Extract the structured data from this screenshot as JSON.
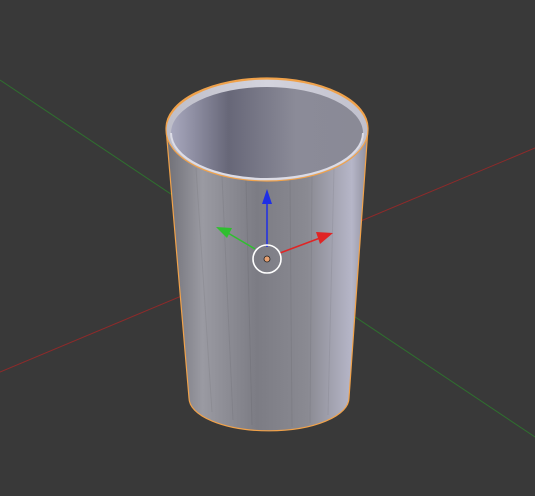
{
  "viewport": {
    "background": "#393939",
    "axes": {
      "x_axis_color": "#8e2a2a",
      "y_axis_color": "#2f6f2f"
    },
    "object": {
      "name": "cup",
      "selected": true,
      "outline_color": "#f1a24a",
      "body_color": "#a9a9b5"
    },
    "gizmo": {
      "z_arrow_color": "#1f2fe6",
      "x_arrow_color": "#e02424",
      "y_arrow_color": "#2fbf2f",
      "pivot_color": "#e7a070"
    }
  }
}
